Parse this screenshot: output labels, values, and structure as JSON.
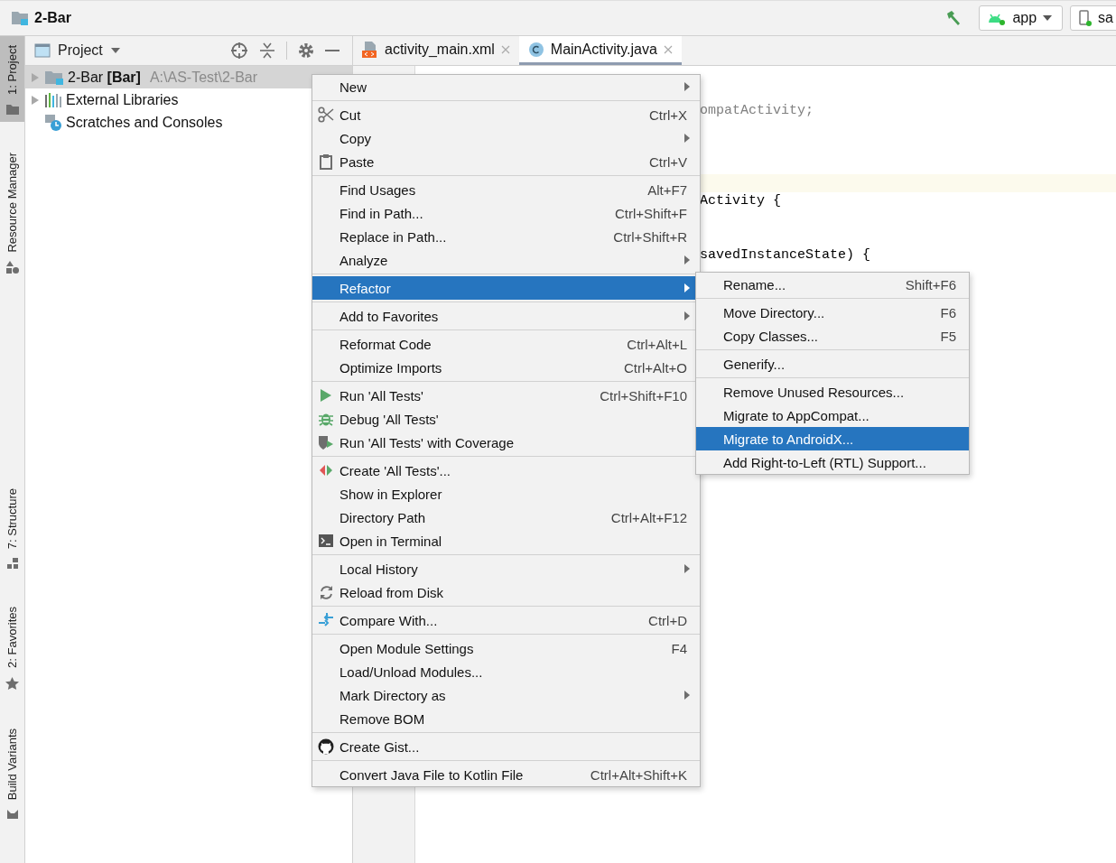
{
  "window": {
    "title": "2-Bar"
  },
  "toolbar": {
    "run_config": "app",
    "device": "sa"
  },
  "tool_stripe": {
    "top": [
      {
        "label": "1: Project",
        "selected": true
      },
      {
        "label": "Resource Manager",
        "selected": false
      }
    ],
    "bottom": [
      {
        "label": "7: Structure",
        "selected": false
      },
      {
        "label": "2: Favorites",
        "selected": false
      },
      {
        "label": "Build Variants",
        "selected": false
      }
    ]
  },
  "project_panel": {
    "title": "Project",
    "tree": [
      {
        "label": "2-Bar **[Bar]**",
        "path": "A:\\AS-Test\\2-Bar",
        "selected": true,
        "expandable": true
      },
      {
        "label": "External Libraries",
        "selected": false,
        "expandable": true
      },
      {
        "label": "Scratches and Consoles",
        "selected": false,
        "expandable": false
      }
    ]
  },
  "editor": {
    "tabs": [
      {
        "label": "activity_main.xml",
        "selected": false
      },
      {
        "label": "MainActivity.java",
        "selected": true
      }
    ],
    "code_fragments": [
      {
        "text": "ompatActivity;",
        "dim": true
      },
      {
        "text": "Activity {",
        "dim": false
      },
      {
        "text": "savedInstanceState) {",
        "dim": false
      }
    ]
  },
  "context_menu": {
    "groups": [
      [
        {
          "label": "New",
          "submenu": true,
          "selected": false
        }
      ],
      [
        {
          "label": "Cut",
          "shortcut": "Ctrl+X",
          "selected": false
        },
        {
          "label": "Copy",
          "submenu": true,
          "selected": false
        },
        {
          "label": "Paste",
          "shortcut": "Ctrl+V",
          "selected": false
        }
      ],
      [
        {
          "label": "Find Usages",
          "shortcut": "Alt+F7",
          "selected": false
        },
        {
          "label": "Find in Path...",
          "shortcut": "Ctrl+Shift+F",
          "selected": false
        },
        {
          "label": "Replace in Path...",
          "shortcut": "Ctrl+Shift+R",
          "selected": false
        },
        {
          "label": "Analyze",
          "submenu": true,
          "selected": false
        }
      ],
      [
        {
          "label": "Refactor",
          "submenu": true,
          "selected": true
        }
      ],
      [
        {
          "label": "Add to Favorites",
          "submenu": true,
          "selected": false
        }
      ],
      [
        {
          "label": "Reformat Code",
          "shortcut": "Ctrl+Alt+L",
          "selected": false
        },
        {
          "label": "Optimize Imports",
          "shortcut": "Ctrl+Alt+O",
          "selected": false
        }
      ],
      [
        {
          "label": "Run 'All Tests'",
          "shortcut": "Ctrl+Shift+F10",
          "selected": false
        },
        {
          "label": "Debug 'All Tests'",
          "selected": false
        },
        {
          "label": "Run 'All Tests' with Coverage",
          "selected": false
        }
      ],
      [
        {
          "label": "Create 'All Tests'...",
          "selected": false
        },
        {
          "label": "Show in Explorer",
          "selected": false
        },
        {
          "label": "Directory Path",
          "shortcut": "Ctrl+Alt+F12",
          "selected": false
        },
        {
          "label": "Open in Terminal",
          "selected": false
        }
      ],
      [
        {
          "label": "Local History",
          "submenu": true,
          "selected": false
        },
        {
          "label": "Reload from Disk",
          "selected": false
        }
      ],
      [
        {
          "label": "Compare With...",
          "shortcut": "Ctrl+D",
          "selected": false
        }
      ],
      [
        {
          "label": "Open Module Settings",
          "shortcut": "F4",
          "selected": false
        },
        {
          "label": "Load/Unload Modules...",
          "selected": false
        },
        {
          "label": "Mark Directory as",
          "submenu": true,
          "selected": false
        },
        {
          "label": "Remove BOM",
          "selected": false
        }
      ],
      [
        {
          "label": "Create Gist...",
          "selected": false
        }
      ],
      [
        {
          "label": "Convert Java File to Kotlin File",
          "shortcut": "Ctrl+Alt+Shift+K",
          "selected": false
        }
      ]
    ]
  },
  "submenu": {
    "groups": [
      [
        {
          "label": "Rename...",
          "shortcut": "Shift+F6",
          "selected": false
        }
      ],
      [
        {
          "label": "Move Directory...",
          "shortcut": "F6",
          "selected": false
        },
        {
          "label": "Copy Classes...",
          "shortcut": "F5",
          "selected": false
        }
      ],
      [
        {
          "label": "Generify...",
          "selected": false
        }
      ],
      [
        {
          "label": "Remove Unused Resources...",
          "selected": false
        },
        {
          "label": "Migrate to AppCompat...",
          "selected": false
        },
        {
          "label": "Migrate to AndroidX...",
          "selected": true
        },
        {
          "label": "Add Right-to-Left (RTL) Support...",
          "selected": false
        }
      ]
    ]
  }
}
